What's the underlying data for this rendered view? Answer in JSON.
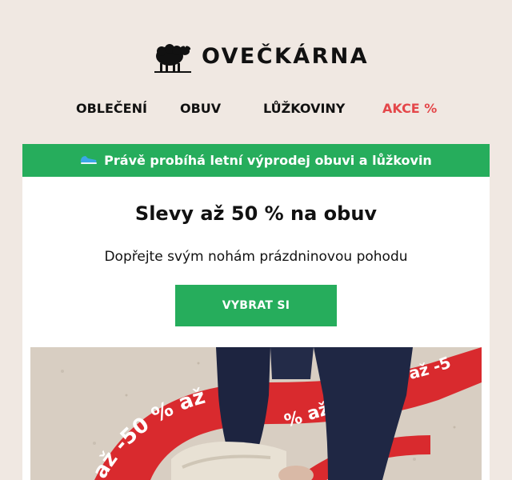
{
  "brand": {
    "name": "OVEČKÁRNA",
    "logo_icon": "sheep-icon"
  },
  "nav": {
    "items": [
      {
        "label": "OBLEČENÍ"
      },
      {
        "label": "OBUV"
      },
      {
        "label": "LŮŽKOVINY"
      },
      {
        "label": "AKCE %"
      }
    ],
    "sale_color": "#e4474a"
  },
  "banner": {
    "icon": "sneaker-icon",
    "text": "Právě probíhá letní výprodej obuvi a lůžkovin",
    "color": "#26ad5c"
  },
  "promo": {
    "headline": "Slevy až 50 % na obuv",
    "subline": "Dopřejte svým nohám prázdninovou pohodu",
    "cta_label": "VYBRAT SI",
    "cta_color": "#26ad5c"
  },
  "hero": {
    "ribbon_text_1": "až -50 % až",
    "ribbon_text_2": "% až",
    "ribbon_text_3": "až -5",
    "ribbon_color": "#d92a2e"
  },
  "colors": {
    "background": "#f0e8e2",
    "text": "#111111"
  }
}
